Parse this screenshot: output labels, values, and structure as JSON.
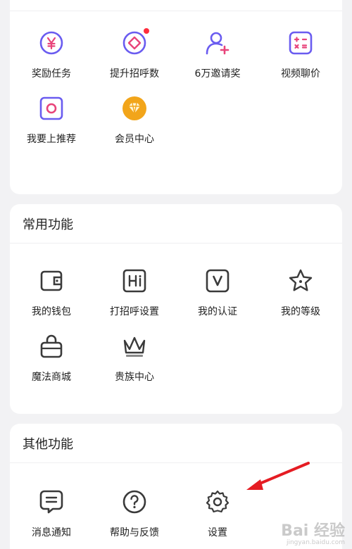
{
  "colors": {
    "purple_accent": "#6a5cf0",
    "pink_accent": "#e8447a",
    "gold": "#f2a51a",
    "dark_icon": "#3a3a3a",
    "arrow": "#e51c23"
  },
  "sections": {
    "top": {
      "items": [
        {
          "label": "奖励任务",
          "icon": "yen-coin-icon"
        },
        {
          "label": "提升招呼数",
          "icon": "diamond-circle-icon"
        },
        {
          "label": "6万邀请奖",
          "icon": "person-add-icon"
        },
        {
          "label": "视频聊价",
          "icon": "calculator-icon"
        },
        {
          "label": "我要上推荐",
          "icon": "square-ring-icon"
        },
        {
          "label": "会员中心",
          "icon": "vip-diamond-icon"
        }
      ]
    },
    "common": {
      "title": "常用功能",
      "items": [
        {
          "label": "我的钱包",
          "icon": "wallet-icon"
        },
        {
          "label": "打招呼设置",
          "icon": "hi-icon"
        },
        {
          "label": "我的认证",
          "icon": "verify-v-icon"
        },
        {
          "label": "我的等级",
          "icon": "star-icon"
        },
        {
          "label": "魔法商城",
          "icon": "shopping-bag-icon"
        },
        {
          "label": "贵族中心",
          "icon": "crown-icon"
        }
      ]
    },
    "other": {
      "title": "其他功能",
      "items": [
        {
          "label": "消息通知",
          "icon": "message-icon"
        },
        {
          "label": "帮助与反馈",
          "icon": "help-icon"
        },
        {
          "label": "设置",
          "icon": "gear-icon"
        }
      ]
    }
  },
  "watermark": {
    "brand": "Bai 经验",
    "url": "jingyan.baidu.com"
  }
}
